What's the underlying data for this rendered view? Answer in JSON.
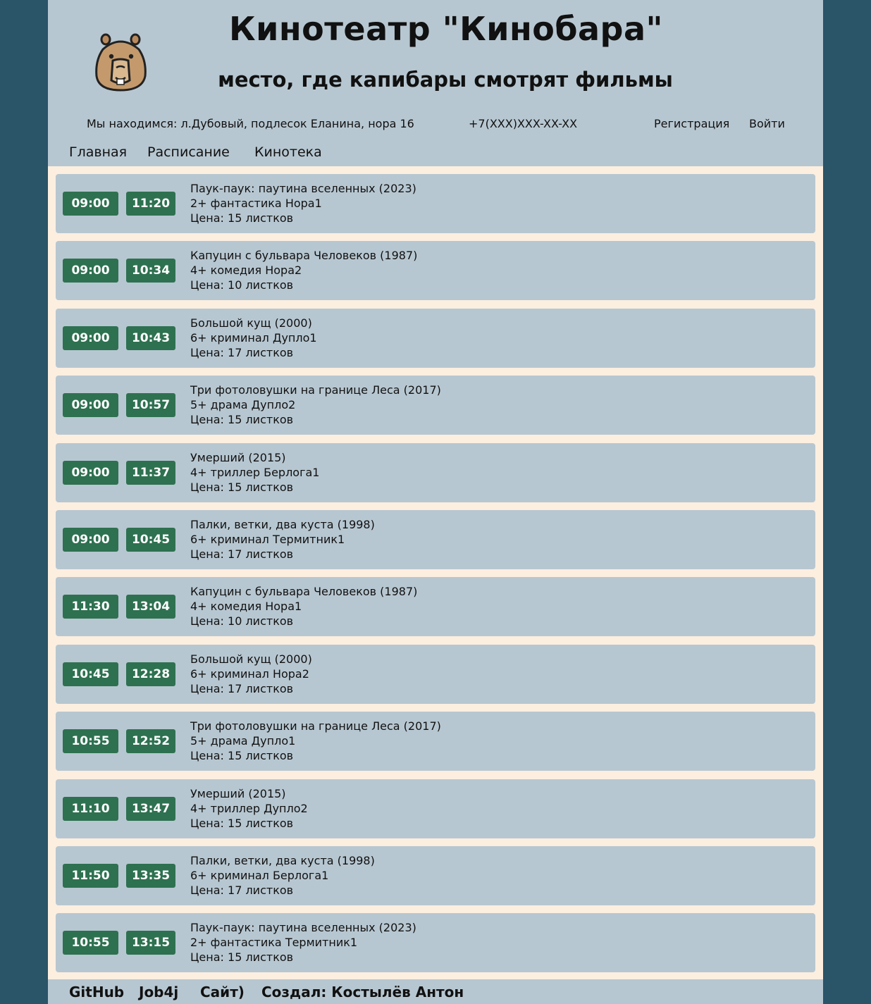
{
  "header": {
    "title": "Кинотеатр \"Кинобара\"",
    "subtitle": "место, где капибары смотрят фильмы",
    "address": "Мы находимся: л.Дубовый, подлесок Еланина, нора 16",
    "phone": "+7(XXX)XXX-XX-XX",
    "register_label": "Регистрация",
    "login_label": "Войти"
  },
  "nav": {
    "home": "Главная",
    "schedule": "Расписание",
    "library": "Кинотека"
  },
  "sessions": [
    {
      "start": "09:00",
      "end": "11:20",
      "title": "Паук-паук: паутина вселенных (2023)",
      "details": "2+ фантастика Нора1",
      "price": "Цена: 15 листков"
    },
    {
      "start": "09:00",
      "end": "10:34",
      "title": "Капуцин с бульвара Человеков (1987)",
      "details": "4+ комедия Нора2",
      "price": "Цена: 10 листков"
    },
    {
      "start": "09:00",
      "end": "10:43",
      "title": "Большой кущ (2000)",
      "details": "6+ криминал Дупло1",
      "price": "Цена: 17 листков"
    },
    {
      "start": "09:00",
      "end": "10:57",
      "title": "Три фотоловушки на границе Леса (2017)",
      "details": "5+ драма Дупло2",
      "price": "Цена: 15 листков"
    },
    {
      "start": "09:00",
      "end": "11:37",
      "title": "Умерший (2015)",
      "details": "4+ триллер Берлога1",
      "price": "Цена: 15 листков"
    },
    {
      "start": "09:00",
      "end": "10:45",
      "title": "Палки, ветки, два куста (1998)",
      "details": "6+ криминал Термитник1",
      "price": "Цена: 17 листков"
    },
    {
      "start": "11:30",
      "end": "13:04",
      "title": "Капуцин с бульвара Человеков (1987)",
      "details": "4+ комедия Нора1",
      "price": "Цена: 10 листков"
    },
    {
      "start": "10:45",
      "end": "12:28",
      "title": "Большой кущ (2000)",
      "details": "6+ криминал Нора2",
      "price": "Цена: 17 листков"
    },
    {
      "start": "10:55",
      "end": "12:52",
      "title": "Три фотоловушки на границе Леса (2017)",
      "details": "5+ драма Дупло1",
      "price": "Цена: 15 листков"
    },
    {
      "start": "11:10",
      "end": "13:47",
      "title": "Умерший (2015)",
      "details": "4+ триллер Дупло2",
      "price": "Цена: 15 листков"
    },
    {
      "start": "11:50",
      "end": "13:35",
      "title": "Палки, ветки, два куста (1998)",
      "details": "6+ криминал Берлога1",
      "price": "Цена: 17 листков"
    },
    {
      "start": "10:55",
      "end": "13:15",
      "title": "Паук-паук: паутина вселенных (2023)",
      "details": "2+ фантастика Термитник1",
      "price": "Цена: 15 листков"
    }
  ],
  "footer": {
    "github": "GitHub",
    "job4j": "Job4j",
    "site": "Сайт)",
    "author": "Создал: Костылёв Антон"
  },
  "colors": {
    "background": "#2a5468",
    "panel": "#b7c7d1",
    "content_bg": "#fcefe0",
    "button": "#2e7150"
  }
}
